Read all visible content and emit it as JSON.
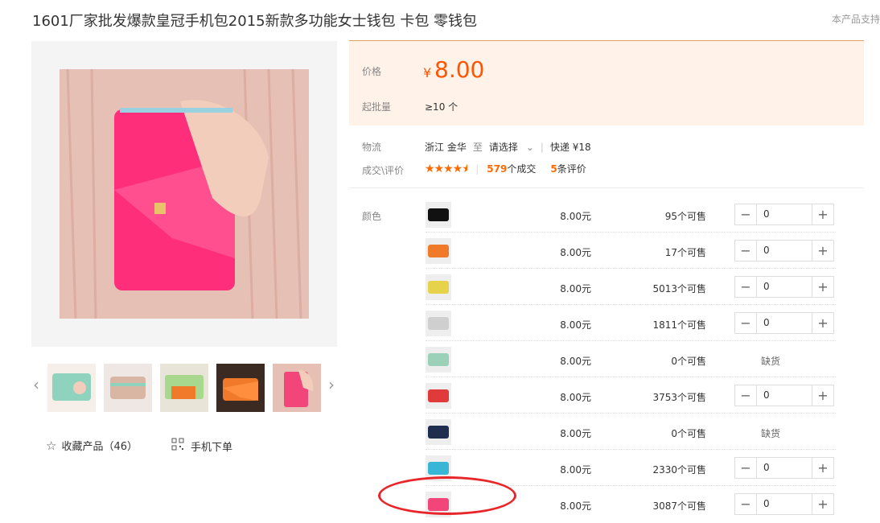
{
  "product": {
    "title": "1601厂家批发爆款皇冠手机包2015新款多功能女士钱包 卡包 零钱包",
    "support_text": "本产品支持"
  },
  "price_box": {
    "price_label": "价格",
    "currency": "¥",
    "price": "8.00",
    "moq_label": "起批量",
    "moq_value": "≥10 个"
  },
  "logistics": {
    "label": "物流",
    "origin": "浙江 金华",
    "to": "至",
    "select": "请选择",
    "express": "快递 ¥18"
  },
  "deals": {
    "label": "成交\\评价",
    "rating": 4.5,
    "deals_count": "579",
    "deals_suffix": "个成交",
    "reviews_count": "5",
    "reviews_suffix": "条评价"
  },
  "color_label": "颜色",
  "sku_rows": [
    {
      "price": "8.00元",
      "stock": "95个可售",
      "qty": "0",
      "available": true,
      "color": "#111111"
    },
    {
      "price": "8.00元",
      "stock": "17个可售",
      "qty": "0",
      "available": true,
      "color": "#f07a2a"
    },
    {
      "price": "8.00元",
      "stock": "5013个可售",
      "qty": "0",
      "available": true,
      "color": "#e6d34a"
    },
    {
      "price": "8.00元",
      "stock": "1811个可售",
      "qty": "0",
      "available": true,
      "color": "#cfcfcf"
    },
    {
      "price": "8.00元",
      "stock": "0个可售",
      "qty": "",
      "available": false,
      "soldout": "缺货",
      "color": "#9ad1b8"
    },
    {
      "price": "8.00元",
      "stock": "3753个可售",
      "qty": "0",
      "available": true,
      "color": "#e03a3a"
    },
    {
      "price": "8.00元",
      "stock": "0个可售",
      "qty": "",
      "available": false,
      "soldout": "缺货",
      "color": "#1f2e4e"
    },
    {
      "price": "8.00元",
      "stock": "2330个可售",
      "qty": "0",
      "available": true,
      "color": "#38b6d6"
    },
    {
      "price": "8.00元",
      "stock": "3087个可售",
      "qty": "0",
      "available": true,
      "color": "#f2457a"
    }
  ],
  "thumbnails": [
    {
      "color": "#8fd3bf"
    },
    {
      "color": "#d9b6a3"
    },
    {
      "color": "#a7d88e"
    },
    {
      "color": "#f07a2a"
    },
    {
      "color": "#f2457a"
    }
  ],
  "actions": {
    "favorite": "收藏产品（46）",
    "mobile_order": "手机下单"
  },
  "colors": {
    "accent": "#ff5500",
    "price_bg": "#fff2e8",
    "annotation": "#e8262a"
  }
}
